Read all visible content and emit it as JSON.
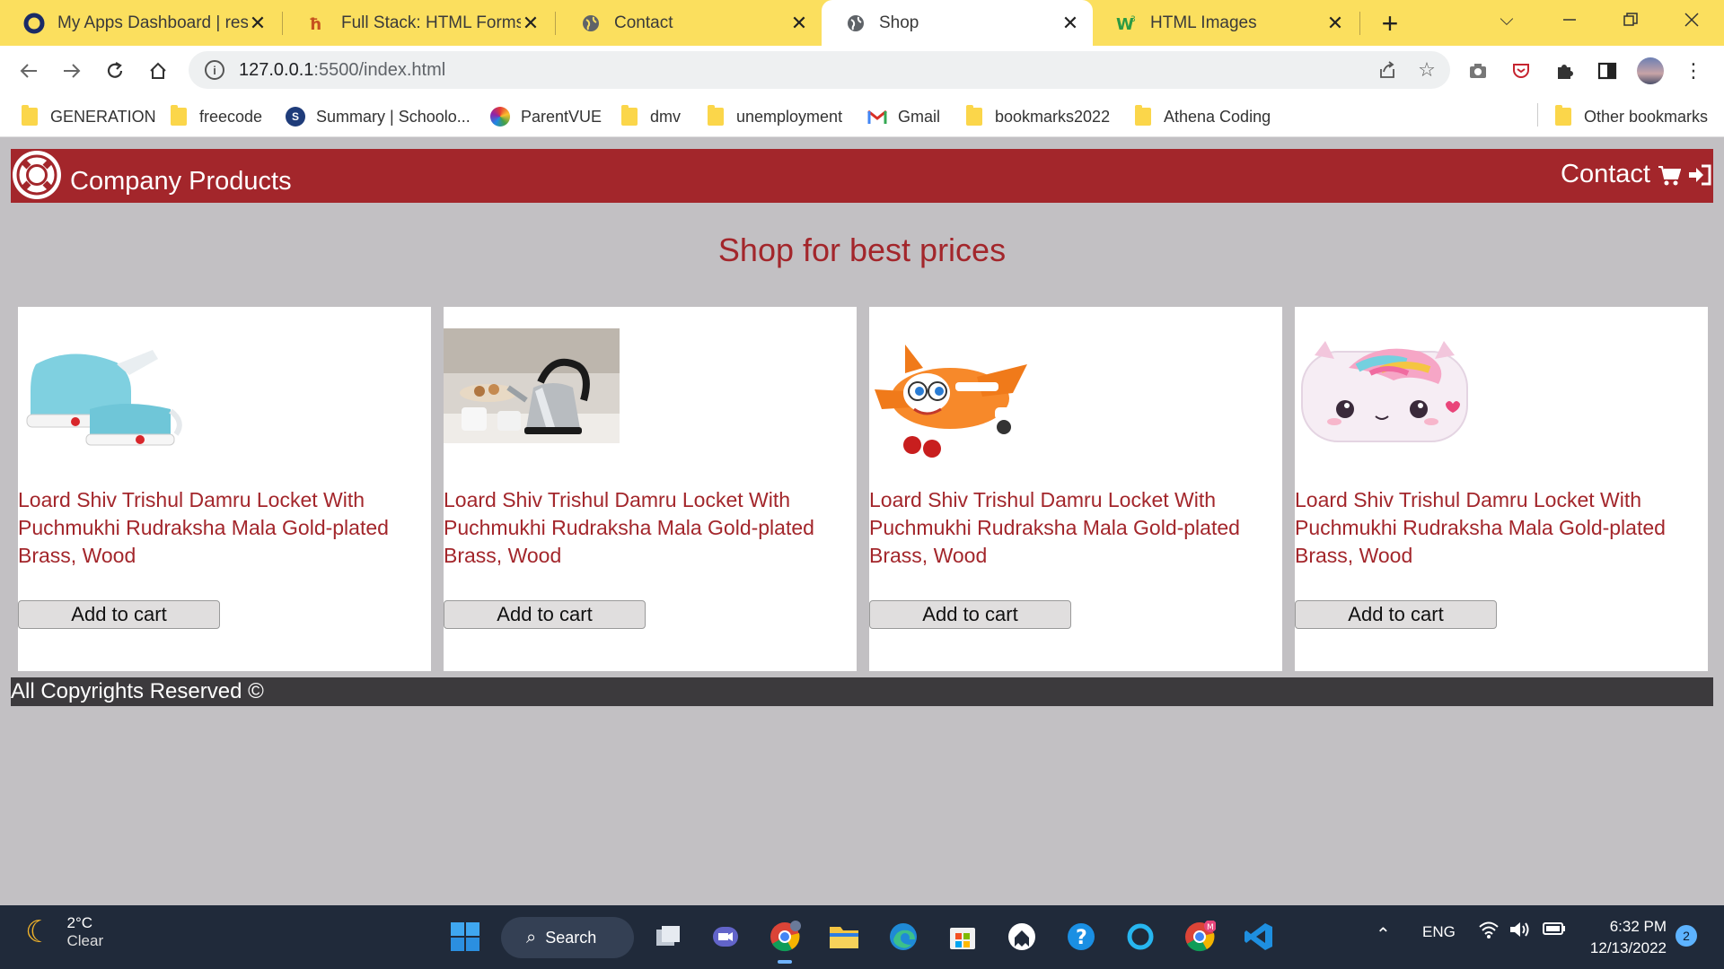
{
  "browser": {
    "tabs": [
      {
        "title": "My Apps Dashboard | resl",
        "icon": "okta-icon"
      },
      {
        "title": "Full Stack: HTML Forms",
        "icon": "generation-icon"
      },
      {
        "title": "Contact",
        "icon": "globe-icon"
      },
      {
        "title": "Shop",
        "icon": "globe-icon",
        "active": true
      },
      {
        "title": "HTML Images",
        "icon": "w3schools-icon"
      }
    ],
    "url_host": "127.0.0.1",
    "url_rest": ":5500/index.html",
    "bookmarks": [
      "GENERATION",
      "freecode",
      "Summary | Schoolo...",
      "ParentVUE",
      "dmv",
      "unemployment",
      "Gmail",
      "bookmarks2022",
      "Athena Coding"
    ],
    "other_bookmarks": "Other bookmarks"
  },
  "page": {
    "brand": "Company Products",
    "nav_contact": "Contact",
    "title": "Shop for best prices",
    "products": [
      {
        "name": "Loard Shiv Trishul Damru Locket With Puchmukhi Rudraksha Mala Gold-plated Brass, Wood",
        "button": "Add to cart",
        "image": "blue-foldable-kettle"
      },
      {
        "name": "Loard Shiv Trishul Damru Locket With Puchmukhi Rudraksha Mala Gold-plated Brass, Wood",
        "button": "Add to cart",
        "image": "steel-kettle"
      },
      {
        "name": "Loard Shiv Trishul Damru Locket With Puchmukhi Rudraksha Mala Gold-plated Brass, Wood",
        "button": "Add to cart",
        "image": "orange-toy-plane"
      },
      {
        "name": "Loard Shiv Trishul Damru Locket With Puchmukhi Rudraksha Mala Gold-plated Brass, Wood",
        "button": "Add to cart",
        "image": "unicorn-box"
      }
    ],
    "footer": "All Copyrights Reserved ©"
  },
  "taskbar": {
    "temp": "2°C",
    "condition": "Clear",
    "search": "Search",
    "lang": "ENG",
    "time": "6:32 PM",
    "date": "12/13/2022",
    "notifications": "2"
  },
  "colors": {
    "tab_bar": "#fbdf5e",
    "header": "#a3262b",
    "page_bg": "#c2c0c3",
    "footer": "#3c3a3d",
    "taskbar": "#202a3a"
  }
}
